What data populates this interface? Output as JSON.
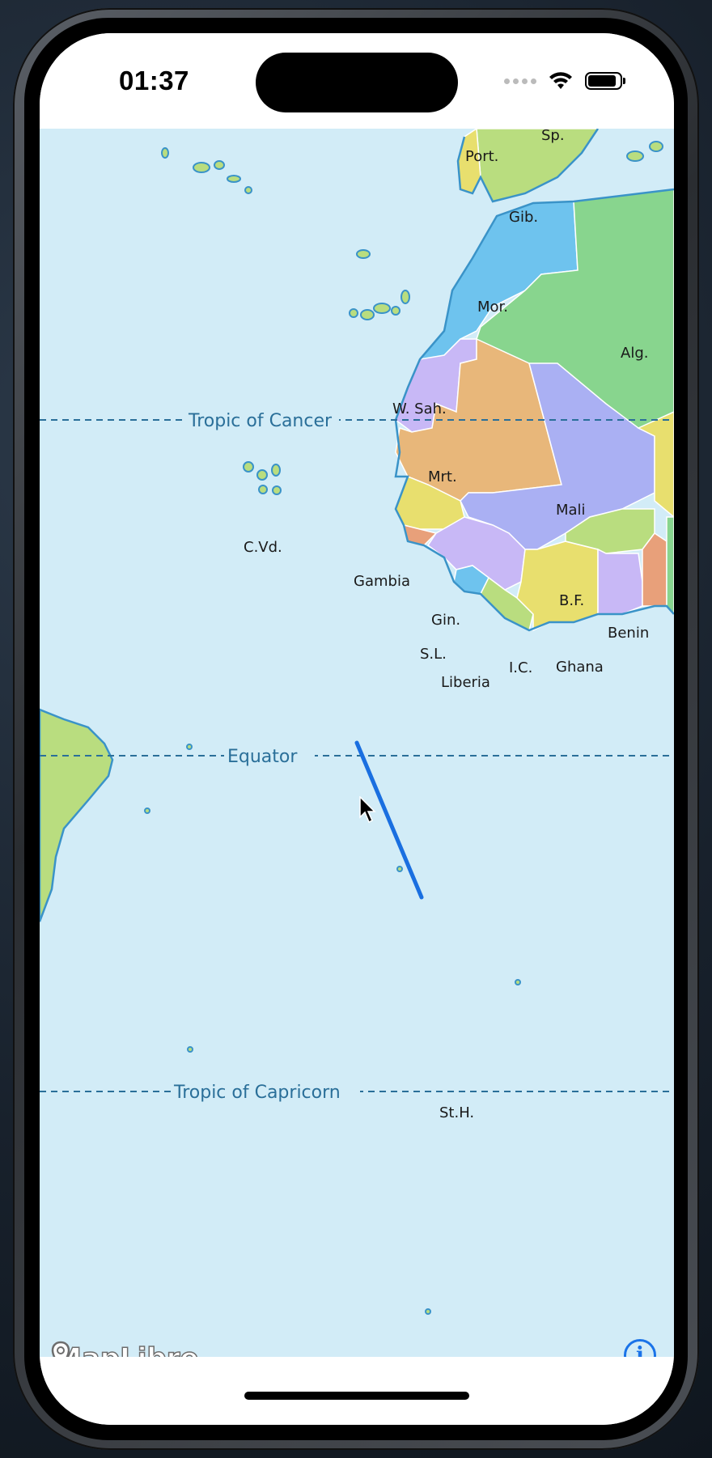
{
  "status_bar": {
    "time": "01:37"
  },
  "map": {
    "attribution": "MapLibre",
    "info_icon_glyph": "i",
    "latitude_lines": [
      {
        "name": "Tropic of Cancer"
      },
      {
        "name": "Equator"
      },
      {
        "name": "Tropic of Capricorn"
      }
    ],
    "country_labels": {
      "spain": "Sp.",
      "portugal": "Port.",
      "gibraltar": "Gib.",
      "morocco": "Mor.",
      "algeria": "Alg.",
      "western_sahara": "W. Sah.",
      "mauritania": "Mrt.",
      "mali": "Mali",
      "cape_verde": "C.Vd.",
      "gambia": "Gambia",
      "burkina_faso": "B.F.",
      "guinea": "Gin.",
      "benin": "Benin",
      "sierra_leone": "S.L.",
      "ivory_coast": "I.C.",
      "ghana": "Ghana",
      "liberia": "Liberia",
      "saint_helena": "St.H."
    },
    "colors": {
      "ocean": "#d2ecf7",
      "coastline": "#3a93c8",
      "route_line": "#1a6fe0"
    }
  }
}
